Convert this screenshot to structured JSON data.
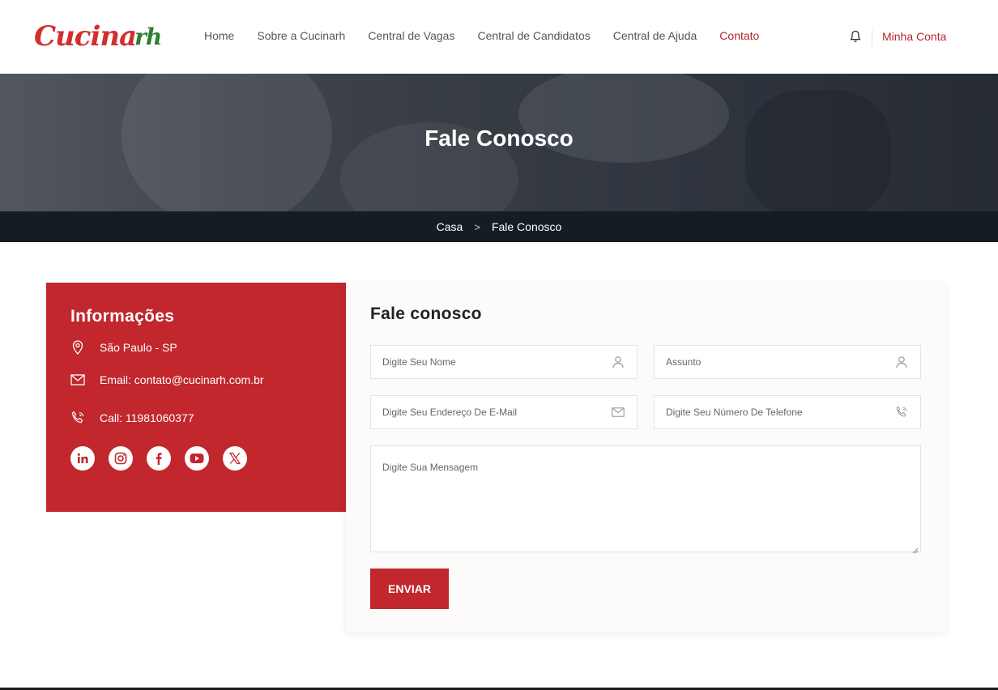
{
  "header": {
    "logo_part1": "Cucina",
    "logo_part2": "rh",
    "nav": [
      "Home",
      "Sobre a Cucinarh",
      "Central de Vagas",
      "Central de Candidatos",
      "Central de Ajuda",
      "Contato"
    ],
    "active_nav": "Contato",
    "account_label": "Minha Conta"
  },
  "hero": {
    "title": "Fale Conosco",
    "breadcrumb_home": "Casa",
    "breadcrumb_sep": ">",
    "breadcrumb_current": "Fale Conosco"
  },
  "info": {
    "title": "Informações",
    "location": "São Paulo - SP",
    "email": "Email: contato@cucinarh.com.br",
    "phone": "Call: 11981060377",
    "socials": [
      "linkedin",
      "instagram",
      "facebook",
      "youtube",
      "x"
    ]
  },
  "form": {
    "title": "Fale conosco",
    "name_placeholder": "Digite Seu Nome",
    "subject_placeholder": "Assunto",
    "email_placeholder": "Digite Seu Endereço De E-Mail",
    "phone_placeholder": "Digite Seu Número De Telefone",
    "message_placeholder": "Digite Sua Mensagem",
    "submit_label": "ENVIAR"
  },
  "colors": {
    "brand_red": "#c1272d",
    "dark_bar": "#151c24",
    "logo_green": "#2e7d32"
  }
}
